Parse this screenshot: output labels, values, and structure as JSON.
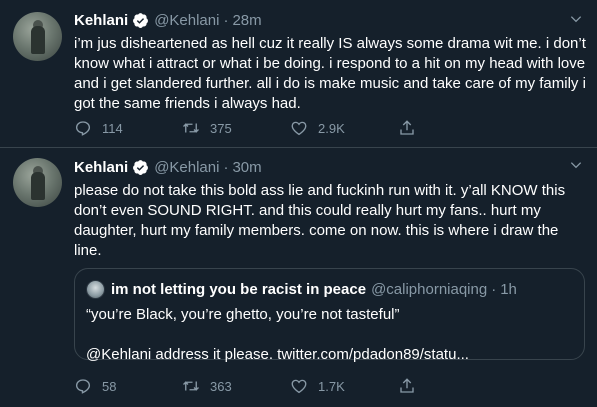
{
  "colors": {
    "background": "#15202b",
    "border": "#38444d",
    "secondary_text": "#8899a6",
    "verified_badge": "#ffffff"
  },
  "tweets": [
    {
      "display_name": "Kehlani",
      "handle": "@Kehlani",
      "dot": "·",
      "time": "28m",
      "text": "i’m jus disheartened as hell cuz it really IS always some drama wit me. i don’t know what i attract or what i be doing. i respond to a hit on my head with love and i get slandered further. all i do is make music and take care of my family i got the same friends i always had.",
      "replies": "114",
      "retweets": "375",
      "likes": "2.9K"
    },
    {
      "display_name": "Kehlani",
      "handle": "@Kehlani",
      "dot": "·",
      "time": "30m",
      "text": "please do not take this bold ass lie and fuckinh run with it. y’all KNOW this don’t even SOUND RIGHT. and this could really hurt my fans.. hurt my daughter, hurt my family members. come on now. this is where i draw the line.",
      "replies": "58",
      "retweets": "363",
      "likes": "1.7K",
      "quote": {
        "display_name": "im not letting you be racist in peace",
        "handle": "@caliphorniaqing",
        "dot": "·",
        "time": "1h",
        "line1": "“you’re Black, you’re ghetto, you’re not tasteful”",
        "line2": "@Kehlani address it please. twitter.com/pdadon89/statu..."
      }
    }
  ],
  "icons": {
    "verified": "verified-badge-icon",
    "more": "chevron-down-icon",
    "reply": "reply-icon",
    "retweet": "retweet-icon",
    "like": "like-icon",
    "share": "share-icon"
  }
}
